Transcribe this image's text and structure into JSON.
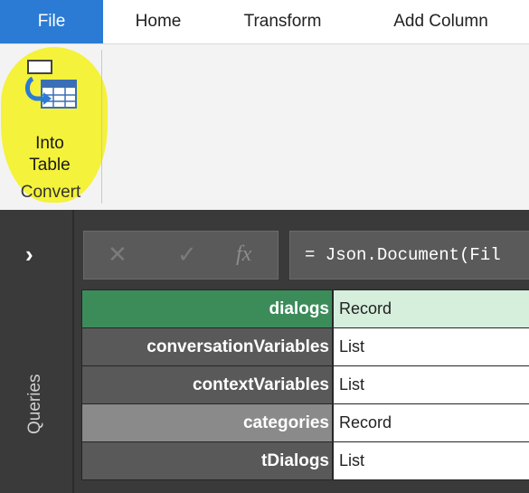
{
  "ribbon_tabs": {
    "file": "File",
    "home": "Home",
    "transform": "Transform",
    "add_column": "Add Column"
  },
  "ribbon": {
    "into_table_line1": "Into",
    "into_table_line2": "Table",
    "group_label": "Convert",
    "highlight_color": "#f4f23a"
  },
  "queries_pane": {
    "toggle": "›",
    "label": "Queries"
  },
  "formula_bar": {
    "cancel": "✕",
    "commit": "✓",
    "fx": "fx",
    "formula": "= Json.Document(Fil"
  },
  "record": {
    "rows": [
      {
        "key": "dialogs",
        "value": "Record"
      },
      {
        "key": "conversationVariables",
        "value": "List"
      },
      {
        "key": "contextVariables",
        "value": "List"
      },
      {
        "key": "categories",
        "value": "Record"
      },
      {
        "key": "tDialogs",
        "value": "List"
      }
    ]
  },
  "colors": {
    "file_tab": "#2b7bd5",
    "selected_key": "#3c8c5a",
    "selected_value": "#d6efdc"
  }
}
